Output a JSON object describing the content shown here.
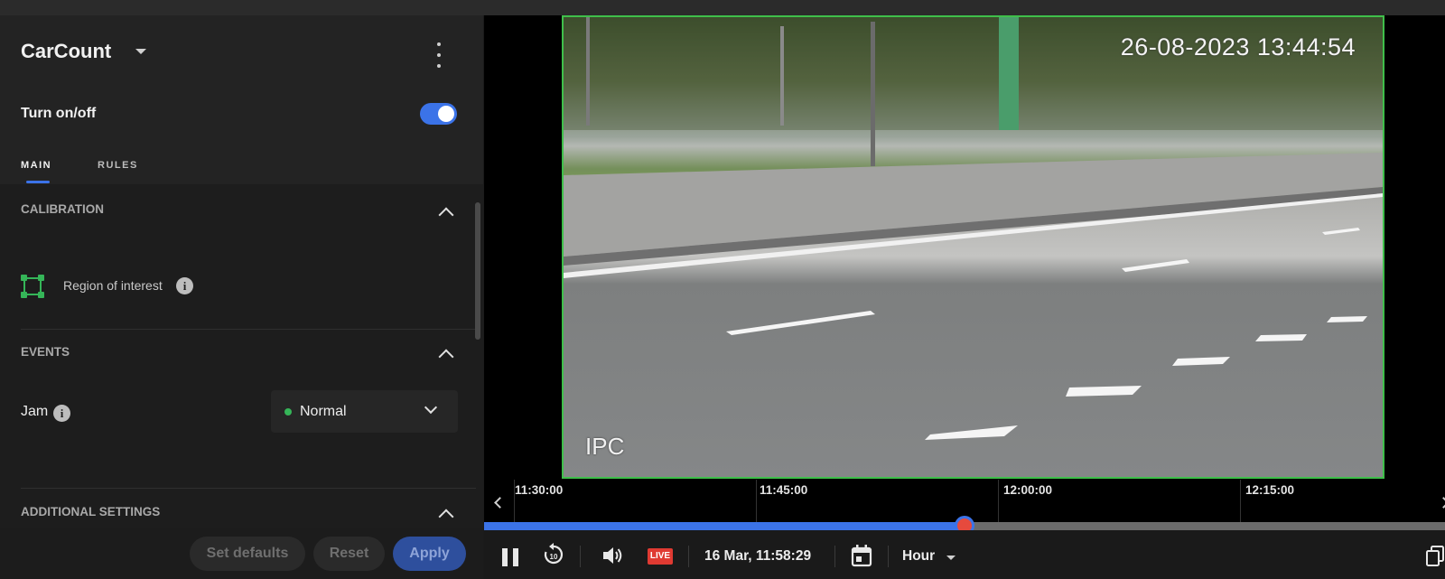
{
  "panel": {
    "title": "CarCount",
    "toggle_label": "Turn on/off",
    "toggle_on": true,
    "tabs": [
      {
        "label": "MAIN",
        "active": true
      },
      {
        "label": "RULES",
        "active": false
      }
    ],
    "sections": {
      "calibration": {
        "title": "CALIBRATION",
        "roi_label": "Region of interest"
      },
      "events": {
        "title": "EVENTS",
        "jam_label": "Jam",
        "jam_value": "Normal",
        "jam_status_color": "#35b558"
      },
      "additional": {
        "title": "ADDITIONAL SETTINGS"
      }
    },
    "buttons": {
      "set_defaults": "Set defaults",
      "reset": "Reset",
      "apply": "Apply"
    },
    "icons": [
      "chevron-down-icon",
      "more-vert-icon",
      "chevron-up-icon",
      "roi-icon",
      "info-icon"
    ]
  },
  "video": {
    "timestamp": "26-08-2023 13:44:54",
    "osd_label": "IPC",
    "border_color": "#3fbf4a"
  },
  "timeline": {
    "ticks": [
      "11:30:00",
      "11:45:00",
      "12:00:00",
      "12:15:00"
    ],
    "progress_fraction": 0.5,
    "accent": "#3b73e8",
    "thumb_color": "#e64a3d"
  },
  "controls": {
    "live_label": "LIVE",
    "datetime": "16 Mar, 11:58:29",
    "range_label": "Hour",
    "icons": [
      "pause-icon",
      "replay-10-icon",
      "volume-icon",
      "calendar-icon",
      "copy-icon"
    ]
  }
}
